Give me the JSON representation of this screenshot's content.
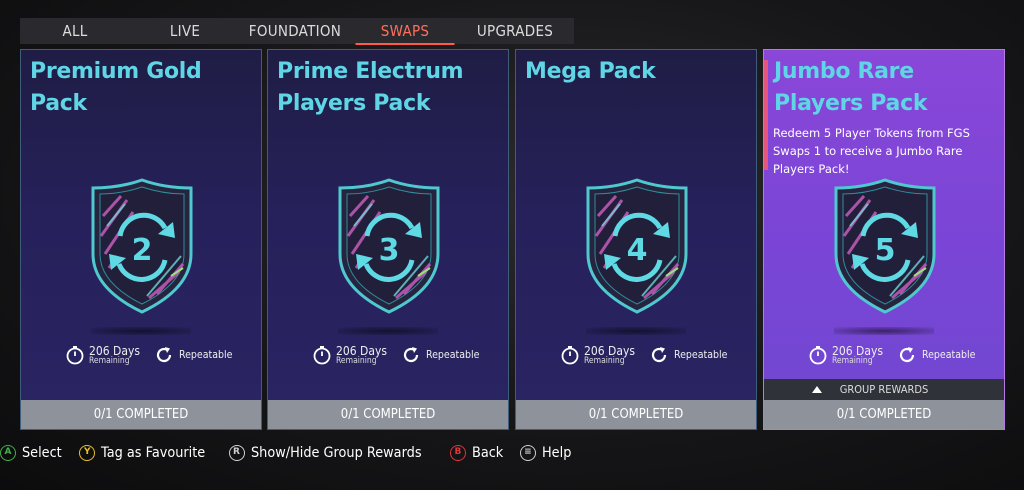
{
  "tabs": [
    {
      "label": "ALL"
    },
    {
      "label": "LIVE"
    },
    {
      "label": "FOUNDATION"
    },
    {
      "label": "SWAPS",
      "active": true
    },
    {
      "label": "UPGRADES"
    }
  ],
  "cards": [
    {
      "title": "Premium Gold Pack",
      "number": "2",
      "days": "206 Days",
      "remaining": "Remaining",
      "repeatable": "Repeatable",
      "status": "0/1 COMPLETED"
    },
    {
      "title": "Prime Electrum Players Pack",
      "number": "3",
      "days": "206 Days",
      "remaining": "Remaining",
      "repeatable": "Repeatable",
      "status": "0/1 COMPLETED"
    },
    {
      "title": "Mega Pack",
      "number": "4",
      "days": "206 Days",
      "remaining": "Remaining",
      "repeatable": "Repeatable",
      "status": "0/1 COMPLETED"
    },
    {
      "title": "Jumbo Rare Players Pack",
      "number": "5",
      "description": "Redeem 5 Player Tokens from FGS Swaps 1 to receive a Jumbo Rare Players Pack!",
      "days": "206 Days",
      "remaining": "Remaining",
      "repeatable": "Repeatable",
      "group_rewards": "GROUP REWARDS",
      "status": "0/1 COMPLETED"
    }
  ],
  "footer": [
    {
      "key": "A",
      "label": "Select",
      "color": "#3fb24a"
    },
    {
      "key": "Y",
      "label": "Tag as Favourite",
      "color": "#e8c12a"
    },
    {
      "key": "R",
      "label": "Show/Hide Group Rewards",
      "color": "#cfcfcf"
    },
    {
      "key": "B",
      "label": "Back",
      "color": "#e0343a"
    },
    {
      "key": "≡",
      "label": "Help",
      "color": "#cfcfcf"
    }
  ],
  "colors": {
    "accent_tab": "#ff6f5c",
    "title_cyan": "#5fd6e6",
    "highlight_card": "#7a45d6"
  },
  "icons": [
    "timer-icon",
    "repeat-icon",
    "shield-swap-badge-icon",
    "triangle-up-icon"
  ]
}
